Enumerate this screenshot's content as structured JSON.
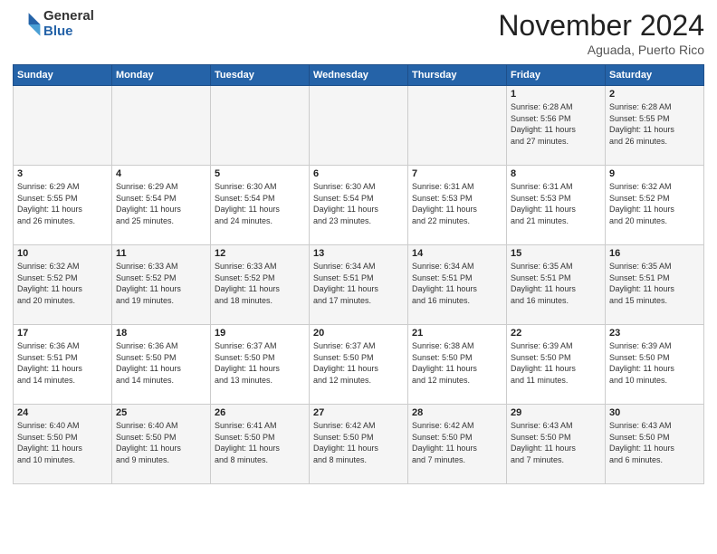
{
  "logo": {
    "general": "General",
    "blue": "Blue"
  },
  "header": {
    "month": "November 2024",
    "location": "Aguada, Puerto Rico"
  },
  "weekdays": [
    "Sunday",
    "Monday",
    "Tuesday",
    "Wednesday",
    "Thursday",
    "Friday",
    "Saturday"
  ],
  "weeks": [
    [
      {
        "day": "",
        "info": ""
      },
      {
        "day": "",
        "info": ""
      },
      {
        "day": "",
        "info": ""
      },
      {
        "day": "",
        "info": ""
      },
      {
        "day": "",
        "info": ""
      },
      {
        "day": "1",
        "info": "Sunrise: 6:28 AM\nSunset: 5:56 PM\nDaylight: 11 hours\nand 27 minutes."
      },
      {
        "day": "2",
        "info": "Sunrise: 6:28 AM\nSunset: 5:55 PM\nDaylight: 11 hours\nand 26 minutes."
      }
    ],
    [
      {
        "day": "3",
        "info": "Sunrise: 6:29 AM\nSunset: 5:55 PM\nDaylight: 11 hours\nand 26 minutes."
      },
      {
        "day": "4",
        "info": "Sunrise: 6:29 AM\nSunset: 5:54 PM\nDaylight: 11 hours\nand 25 minutes."
      },
      {
        "day": "5",
        "info": "Sunrise: 6:30 AM\nSunset: 5:54 PM\nDaylight: 11 hours\nand 24 minutes."
      },
      {
        "day": "6",
        "info": "Sunrise: 6:30 AM\nSunset: 5:54 PM\nDaylight: 11 hours\nand 23 minutes."
      },
      {
        "day": "7",
        "info": "Sunrise: 6:31 AM\nSunset: 5:53 PM\nDaylight: 11 hours\nand 22 minutes."
      },
      {
        "day": "8",
        "info": "Sunrise: 6:31 AM\nSunset: 5:53 PM\nDaylight: 11 hours\nand 21 minutes."
      },
      {
        "day": "9",
        "info": "Sunrise: 6:32 AM\nSunset: 5:52 PM\nDaylight: 11 hours\nand 20 minutes."
      }
    ],
    [
      {
        "day": "10",
        "info": "Sunrise: 6:32 AM\nSunset: 5:52 PM\nDaylight: 11 hours\nand 20 minutes."
      },
      {
        "day": "11",
        "info": "Sunrise: 6:33 AM\nSunset: 5:52 PM\nDaylight: 11 hours\nand 19 minutes."
      },
      {
        "day": "12",
        "info": "Sunrise: 6:33 AM\nSunset: 5:52 PM\nDaylight: 11 hours\nand 18 minutes."
      },
      {
        "day": "13",
        "info": "Sunrise: 6:34 AM\nSunset: 5:51 PM\nDaylight: 11 hours\nand 17 minutes."
      },
      {
        "day": "14",
        "info": "Sunrise: 6:34 AM\nSunset: 5:51 PM\nDaylight: 11 hours\nand 16 minutes."
      },
      {
        "day": "15",
        "info": "Sunrise: 6:35 AM\nSunset: 5:51 PM\nDaylight: 11 hours\nand 16 minutes."
      },
      {
        "day": "16",
        "info": "Sunrise: 6:35 AM\nSunset: 5:51 PM\nDaylight: 11 hours\nand 15 minutes."
      }
    ],
    [
      {
        "day": "17",
        "info": "Sunrise: 6:36 AM\nSunset: 5:51 PM\nDaylight: 11 hours\nand 14 minutes."
      },
      {
        "day": "18",
        "info": "Sunrise: 6:36 AM\nSunset: 5:50 PM\nDaylight: 11 hours\nand 14 minutes."
      },
      {
        "day": "19",
        "info": "Sunrise: 6:37 AM\nSunset: 5:50 PM\nDaylight: 11 hours\nand 13 minutes."
      },
      {
        "day": "20",
        "info": "Sunrise: 6:37 AM\nSunset: 5:50 PM\nDaylight: 11 hours\nand 12 minutes."
      },
      {
        "day": "21",
        "info": "Sunrise: 6:38 AM\nSunset: 5:50 PM\nDaylight: 11 hours\nand 12 minutes."
      },
      {
        "day": "22",
        "info": "Sunrise: 6:39 AM\nSunset: 5:50 PM\nDaylight: 11 hours\nand 11 minutes."
      },
      {
        "day": "23",
        "info": "Sunrise: 6:39 AM\nSunset: 5:50 PM\nDaylight: 11 hours\nand 10 minutes."
      }
    ],
    [
      {
        "day": "24",
        "info": "Sunrise: 6:40 AM\nSunset: 5:50 PM\nDaylight: 11 hours\nand 10 minutes."
      },
      {
        "day": "25",
        "info": "Sunrise: 6:40 AM\nSunset: 5:50 PM\nDaylight: 11 hours\nand 9 minutes."
      },
      {
        "day": "26",
        "info": "Sunrise: 6:41 AM\nSunset: 5:50 PM\nDaylight: 11 hours\nand 8 minutes."
      },
      {
        "day": "27",
        "info": "Sunrise: 6:42 AM\nSunset: 5:50 PM\nDaylight: 11 hours\nand 8 minutes."
      },
      {
        "day": "28",
        "info": "Sunrise: 6:42 AM\nSunset: 5:50 PM\nDaylight: 11 hours\nand 7 minutes."
      },
      {
        "day": "29",
        "info": "Sunrise: 6:43 AM\nSunset: 5:50 PM\nDaylight: 11 hours\nand 7 minutes."
      },
      {
        "day": "30",
        "info": "Sunrise: 6:43 AM\nSunset: 5:50 PM\nDaylight: 11 hours\nand 6 minutes."
      }
    ]
  ]
}
